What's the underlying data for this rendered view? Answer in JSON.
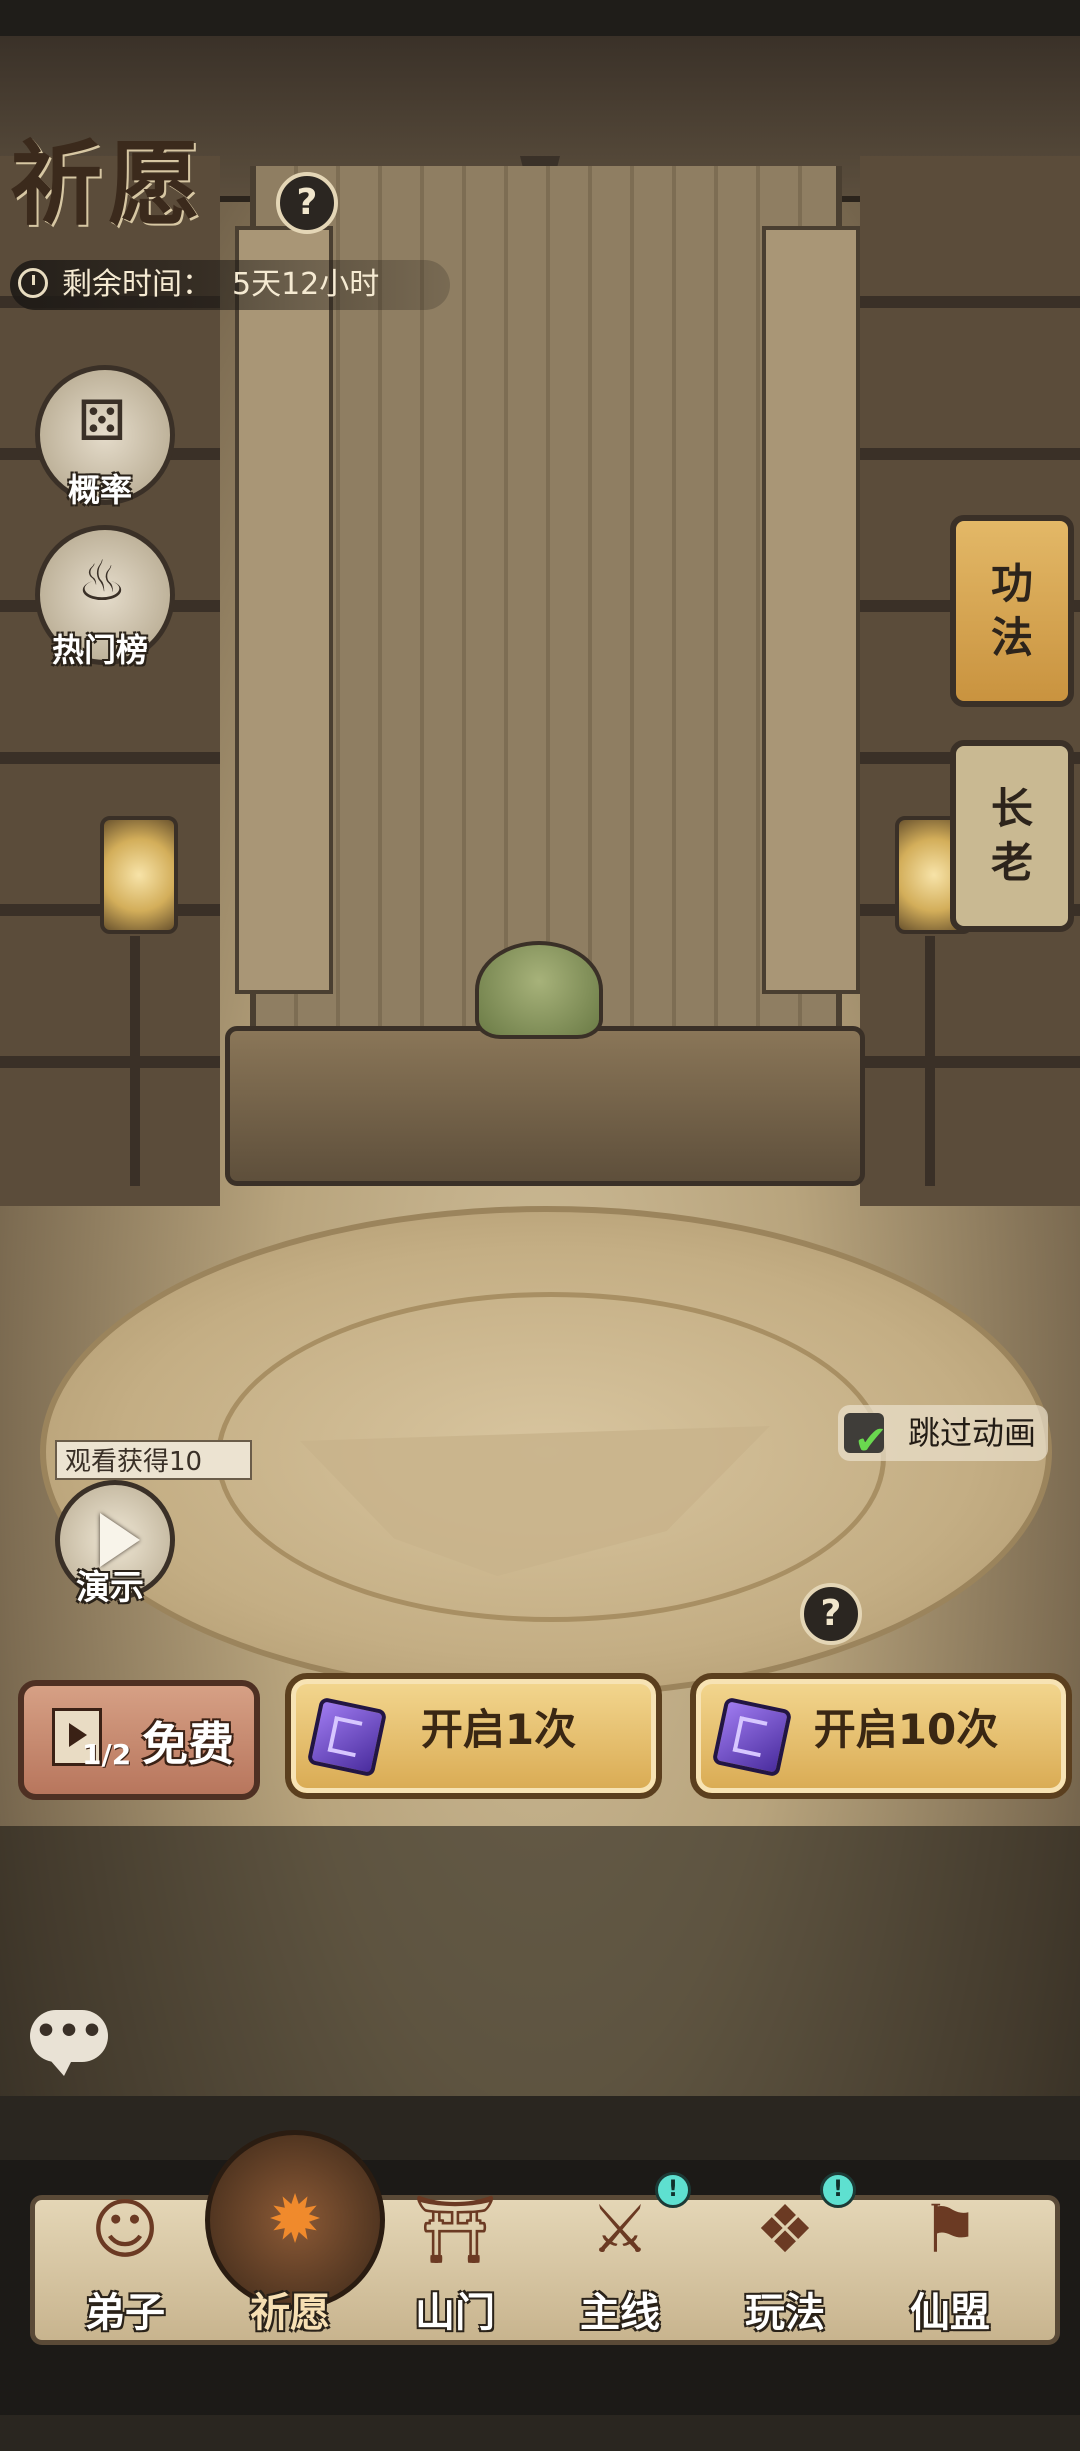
{
  "header": {
    "title": "祈愿",
    "timer_label": "剩余时间：",
    "timer_value": "5天12小时"
  },
  "side_buttons": [
    {
      "label": "概率",
      "icon": "dice-icon"
    },
    {
      "label": "热门榜",
      "icon": "flame-ranking-icon"
    }
  ],
  "right_tabs": [
    {
      "label": "功法",
      "active": true
    },
    {
      "label": "长老",
      "active": false
    }
  ],
  "skip_animation": {
    "label": "跳过动画",
    "checked": true
  },
  "demo": {
    "tag": "观看获得10",
    "label": "演示"
  },
  "actions": {
    "free": {
      "count": "1/2",
      "label": "免费"
    },
    "open_one": {
      "label": "开启1次"
    },
    "open_ten": {
      "label": "开启10次"
    }
  },
  "nav": [
    {
      "label": "弟子",
      "icon": "disciple-icon",
      "active": false,
      "badge": false
    },
    {
      "label": "祈愿",
      "icon": "wish-scroll-icon",
      "active": true,
      "badge": false
    },
    {
      "label": "山门",
      "icon": "sect-gate-icon",
      "active": false,
      "badge": false
    },
    {
      "label": "主线",
      "icon": "main-quest-icon",
      "active": false,
      "badge": true
    },
    {
      "label": "玩法",
      "icon": "gameplay-icon",
      "active": false,
      "badge": true
    },
    {
      "label": "仙盟",
      "icon": "alliance-icon",
      "active": false,
      "badge": false
    }
  ],
  "badge_symbol": "!",
  "help_symbol": "?",
  "chat_symbol": "•••",
  "colors": {
    "accent_gold": "#d9aa52",
    "free_button": "#b8765d",
    "active_tab": "#c9933f",
    "badge": "#5ee0d0"
  }
}
